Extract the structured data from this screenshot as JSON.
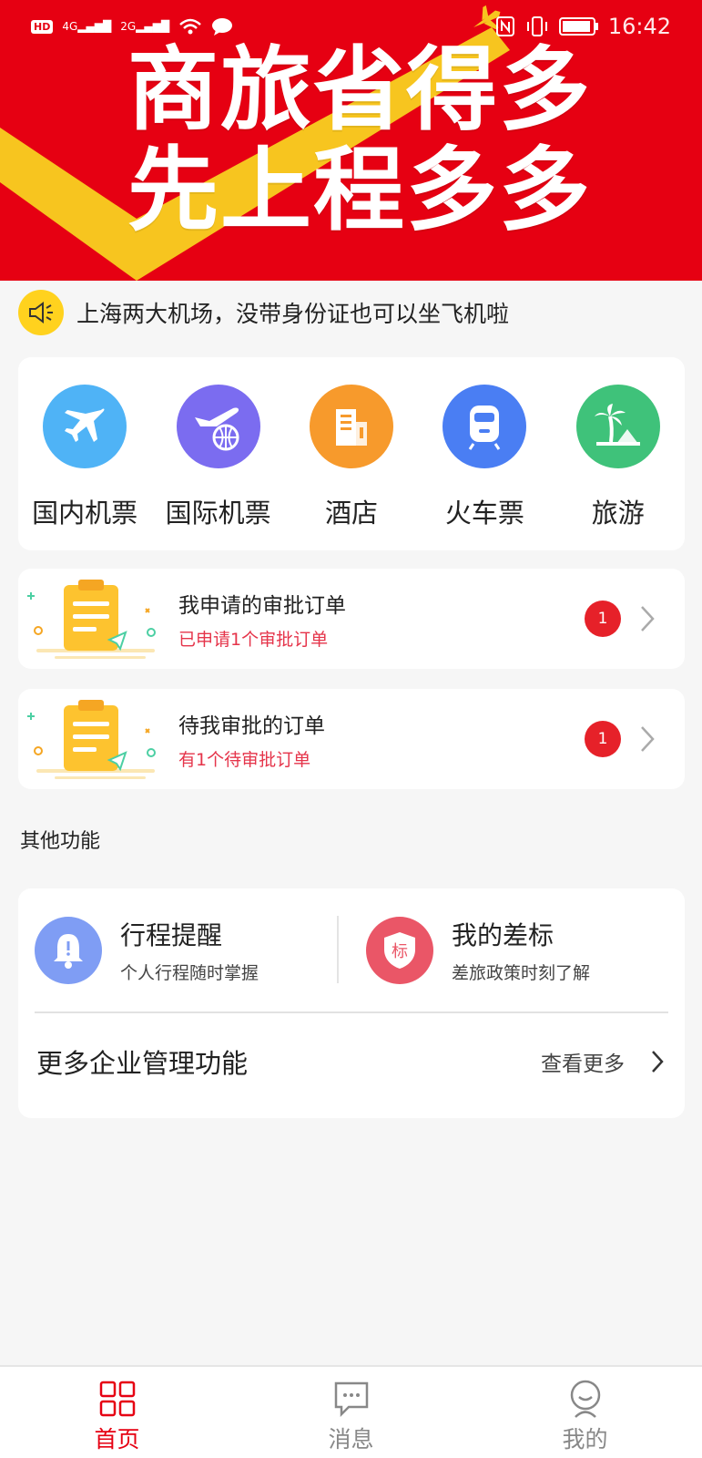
{
  "status_bar": {
    "left_indicators": [
      "HD",
      "4G",
      "2G"
    ],
    "time": "16:42"
  },
  "banner": {
    "line1": "商旅省得多",
    "line2": "先上程多多"
  },
  "notice": {
    "icon": "speaker-icon",
    "text": "上海两大机场，没带身份证也可以坐飞机啦"
  },
  "services": [
    {
      "label": "国内机票",
      "icon": "airplane-icon",
      "color": "#4fb3f6"
    },
    {
      "label": "国际机票",
      "icon": "globe-plane-icon",
      "color": "#7b6cf0"
    },
    {
      "label": "酒店",
      "icon": "building-icon",
      "color": "#f79a2c"
    },
    {
      "label": "火车票",
      "icon": "train-icon",
      "color": "#4a7ef3"
    },
    {
      "label": "旅游",
      "icon": "palm-tree-icon",
      "color": "#3fc27a"
    }
  ],
  "approvals": [
    {
      "title": "我申请的审批订单",
      "sub": "已申请1个审批订单",
      "badge": "1"
    },
    {
      "title": "待我审批的订单",
      "sub": "有1个待审批订单",
      "badge": "1"
    }
  ],
  "other_section": {
    "label": "其他功能",
    "trip_reminder": {
      "title": "行程提醒",
      "sub": "个人行程随时掌握",
      "icon": "bell-icon",
      "color": "#7f9df4"
    },
    "my_standard": {
      "title": "我的差标",
      "sub": "差旅政策时刻了解",
      "icon": "shield-icon",
      "icon_text": "标",
      "color": "#ea5667"
    },
    "more": {
      "title": "更多企业管理功能",
      "link": "查看更多"
    }
  },
  "tabs": [
    {
      "label": "首页",
      "icon": "grid-icon",
      "active": true
    },
    {
      "label": "消息",
      "icon": "message-icon",
      "active": false
    },
    {
      "label": "我的",
      "icon": "person-icon",
      "active": false
    }
  ],
  "colors": {
    "brand": "#e60012",
    "accent_yellow": "#ffd21e"
  }
}
